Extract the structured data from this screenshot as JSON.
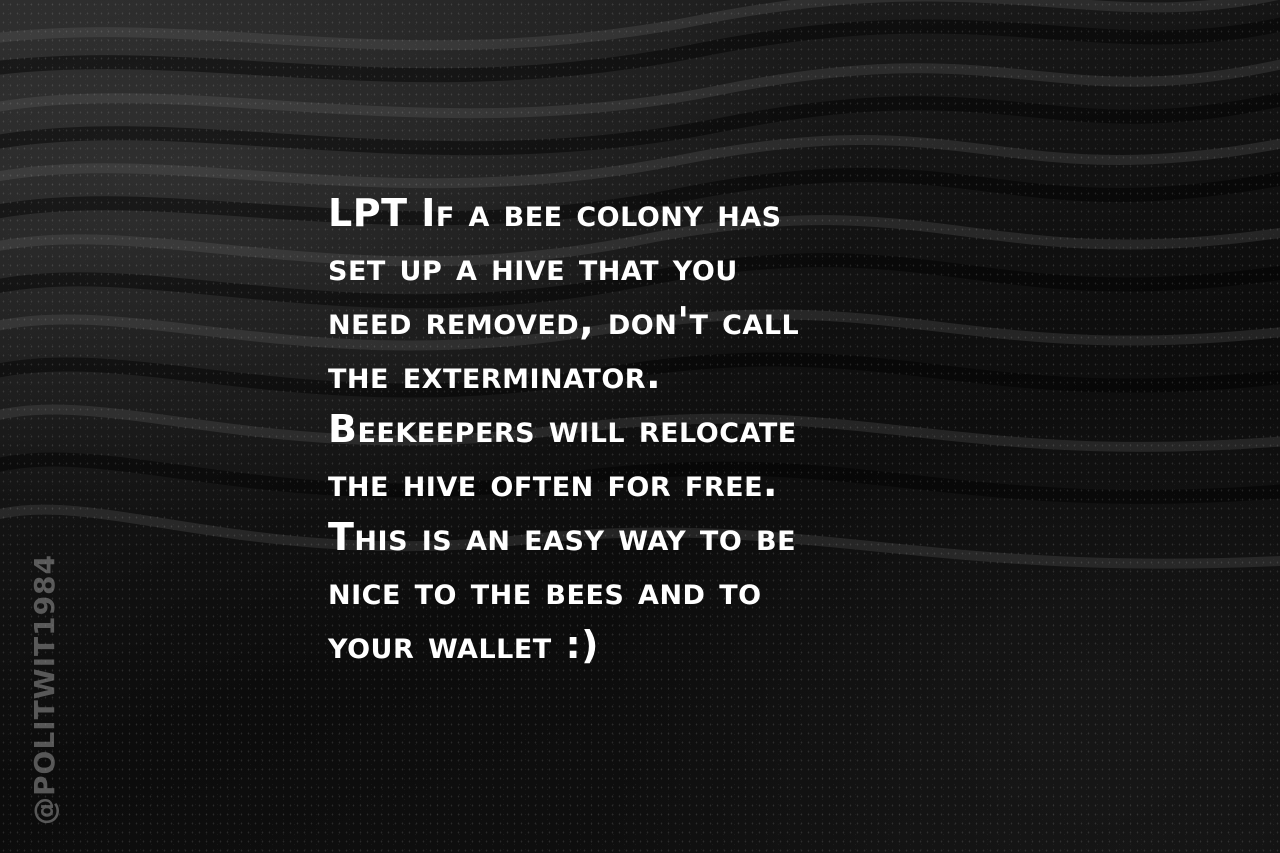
{
  "quote": {
    "text": "LPT If a bee colony has\nset up a hive that you\nneed removed, don't call\nthe exterminator.\nBeekeepers will relocate\nthe hive often for free.\nThis is an easy way to be\nnice to the bees and to\nyour wallet :)"
  },
  "watermark": {
    "text": "@POLITWIT1984"
  },
  "colors": {
    "background": "#0b0b0b",
    "text": "#ffffff",
    "watermark": "#969696"
  }
}
